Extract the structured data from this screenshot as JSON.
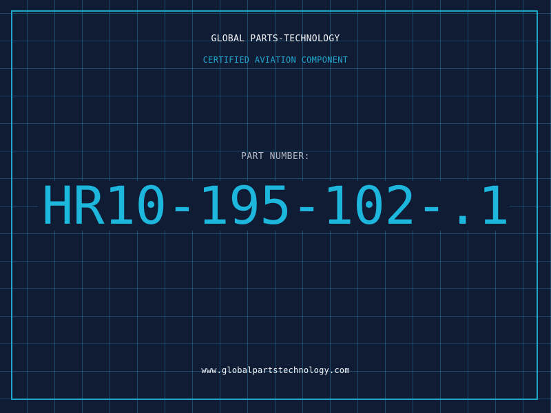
{
  "header": {
    "brand": "GLOBAL PARTS-TECHNOLOGY",
    "subtitle": "CERTIFIED AVIATION COMPONENT"
  },
  "part": {
    "label": "PART NUMBER:",
    "number": "HR10-195-102-.1"
  },
  "footer": {
    "url": "www.globalpartstechnology.com"
  },
  "colors": {
    "background": "#101c34",
    "grid": "#2882aa",
    "accent": "#1db6dd",
    "text": "#f2f4f7",
    "label": "#b6bdc8"
  }
}
